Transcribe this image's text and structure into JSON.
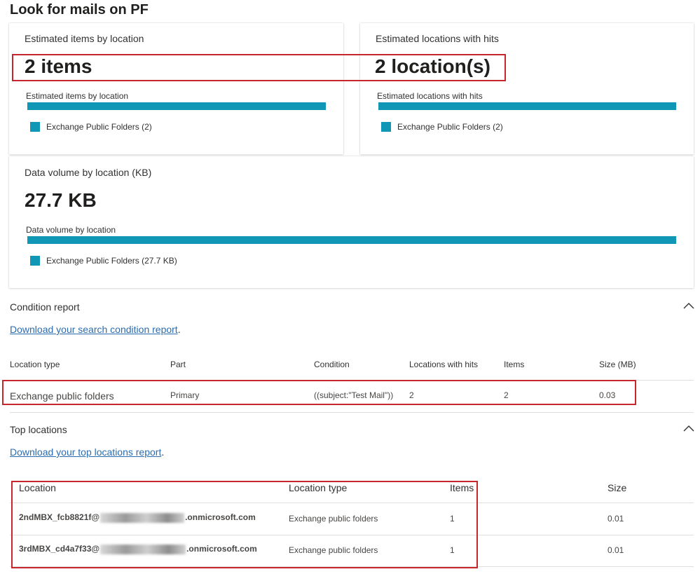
{
  "page": {
    "title": "Look for mails on PF"
  },
  "colors": {
    "bar": "#0f97b5",
    "highlight_border": "#c8262d",
    "link": "#2b6cb0"
  },
  "cards": {
    "items": {
      "heading": "Estimated items by location",
      "value": "2 items",
      "chart_label": "Estimated items by location",
      "legend": "Exchange Public Folders (2)"
    },
    "locations": {
      "heading": "Estimated locations with hits",
      "value": "2 location(s)",
      "chart_label": "Estimated locations with hits",
      "legend": "Exchange Public Folders (2)"
    },
    "volume": {
      "heading": "Data volume by location (KB)",
      "value": "27.7 KB",
      "chart_label": "Data volume by location",
      "legend": "Exchange Public Folders (27.7 KB)"
    }
  },
  "condition_report": {
    "title": "Condition report",
    "download_link": "Download your search condition report",
    "columns": [
      "Location type",
      "Part",
      "Condition",
      "Locations with hits",
      "Items",
      "Size (MB)"
    ],
    "rows": [
      [
        "Exchange public folders",
        "Primary",
        "((subject:\"Test Mail\"))",
        "2",
        "2",
        "0.03"
      ]
    ]
  },
  "top_locations": {
    "title": "Top locations",
    "download_link": "Download your top locations report",
    "columns": [
      "Location",
      "Location type",
      "Items",
      "Size"
    ],
    "rows": [
      {
        "prefix": "2ndMBX_fcb8821f@",
        "suffix": ".onmicrosoft.com",
        "type": "Exchange public folders",
        "items": "1",
        "size": "0.01"
      },
      {
        "prefix": "3rdMBX_cd4a7f33@",
        "suffix": ".onmicrosoft.com",
        "type": "Exchange public folders",
        "items": "1",
        "size": "0.01"
      }
    ]
  },
  "period": "."
}
